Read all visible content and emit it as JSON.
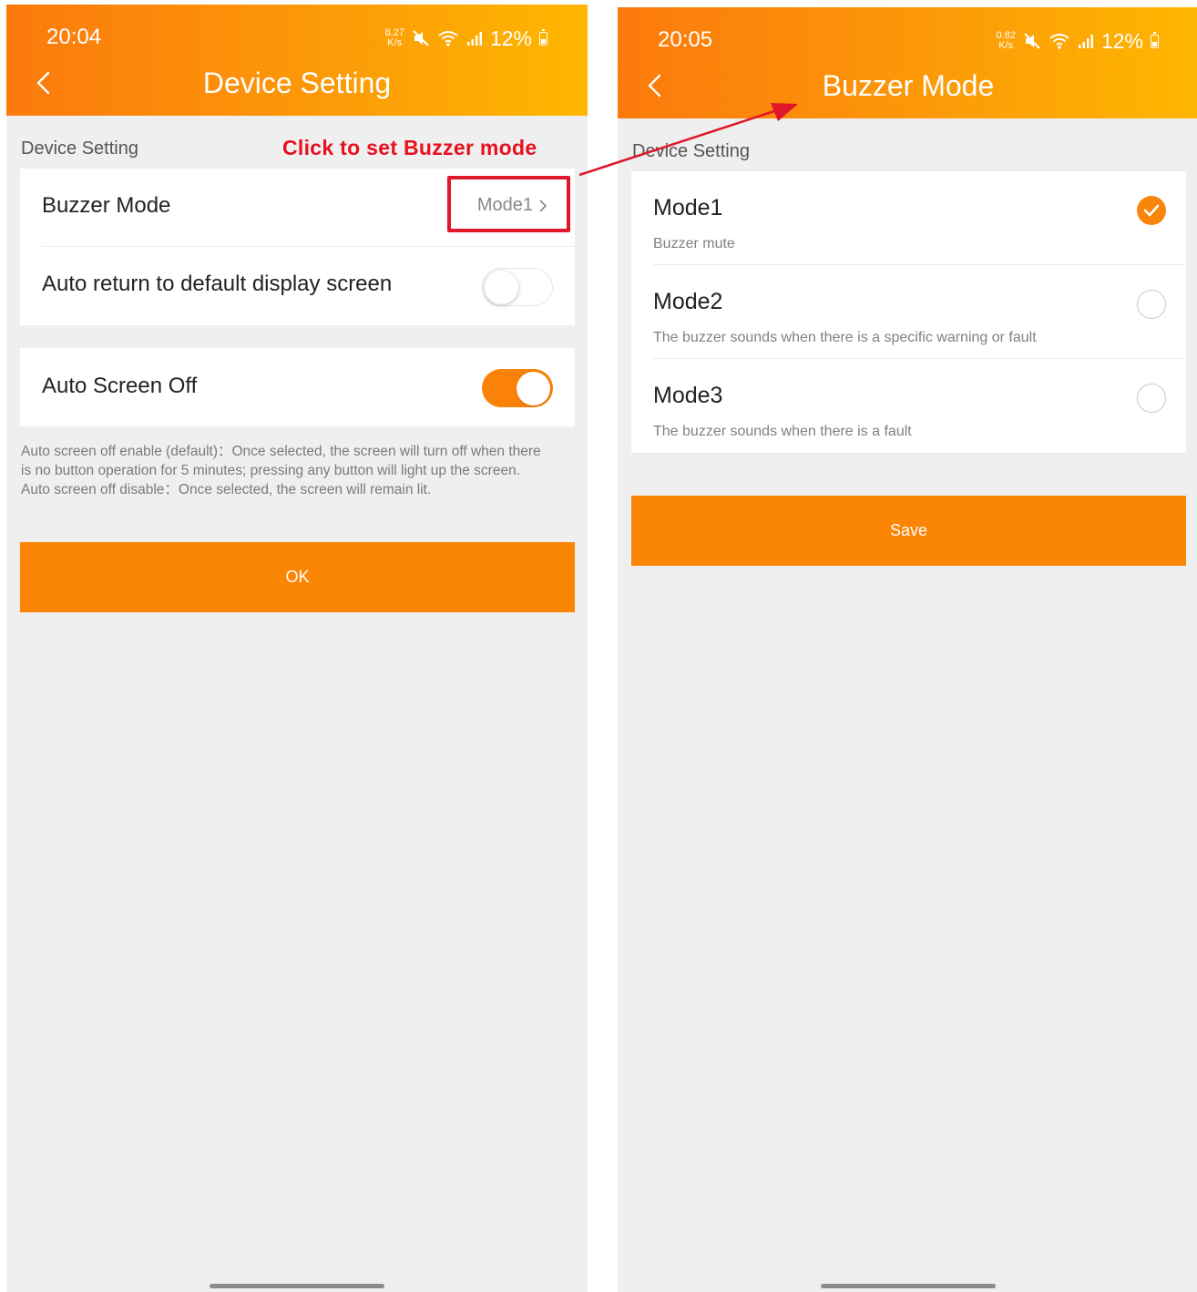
{
  "left_screen": {
    "status": {
      "time": "20:04",
      "net_speed_value": "8.27",
      "net_speed_unit": "K/s",
      "battery": "12%"
    },
    "header": {
      "title": "Device Setting"
    },
    "section_label": "Device Setting",
    "annotation": "Click to set Buzzer mode",
    "settings": {
      "buzzer_mode_label": "Buzzer Mode",
      "buzzer_mode_value": "Mode1",
      "auto_return_label": "Auto return to default display screen",
      "auto_return_enabled": false,
      "auto_screen_off_label": "Auto Screen Off",
      "auto_screen_off_enabled": true
    },
    "note_lines": [
      "Auto screen off enable (default)：Once selected, the screen will turn off when there",
      "is no button operation for 5 minutes; pressing any button will light up the screen.",
      "Auto screen off disable：Once selected, the screen will remain lit."
    ],
    "ok_button": "OK"
  },
  "right_screen": {
    "status": {
      "time": "20:05",
      "net_speed_value": "0.82",
      "net_speed_unit": "K/s",
      "battery": "12%"
    },
    "header": {
      "title": "Buzzer Mode"
    },
    "section_label": "Device Setting",
    "modes": [
      {
        "title": "Mode1",
        "description": "Buzzer mute",
        "selected": true
      },
      {
        "title": "Mode2",
        "description": "The buzzer sounds when there is a specific warning or fault",
        "selected": false
      },
      {
        "title": "Mode3",
        "description": "The buzzer sounds when there is a fault",
        "selected": false
      }
    ],
    "save_button": "Save"
  },
  "colors": {
    "header_gradient_start": "#fb7a0d",
    "header_gradient_end": "#feb700",
    "accent": "#fb8505",
    "annotation_red": "#e0162a",
    "background": "#efefef"
  },
  "icons": [
    "back-arrow-icon",
    "mute-icon",
    "wifi-icon",
    "signal-icon",
    "battery-icon",
    "chevron-right-icon",
    "checkmark-icon"
  ]
}
